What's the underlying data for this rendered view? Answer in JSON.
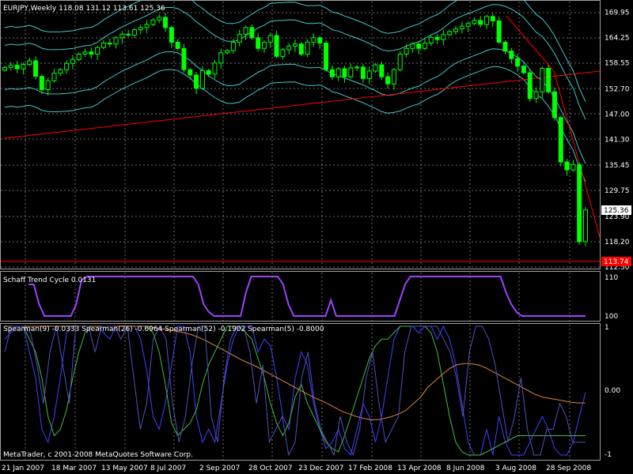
{
  "colors": {
    "background": "#000000",
    "candle": "#00ff00",
    "envelope": "#40c8c8",
    "trendline": "#ff0000",
    "stc": "#a040ff",
    "sp9": "#4040ff",
    "sp26": "#40c040",
    "sp52": "#e08040",
    "sp5": "#5050c0",
    "grid": "#6e6e6e",
    "current_price_box": "#ffffff",
    "low_price_box": "#ff0000"
  },
  "main_chart": {
    "title": "EURJPY,Weekly  118.08 131.12 113.61 125.36",
    "price_labels": [
      "169.95",
      "164.25",
      "158.55",
      "152.70",
      "147.00",
      "141.30",
      "135.45",
      "129.75",
      "123.90",
      "118.20",
      "112.50"
    ],
    "current_price": "125.36",
    "low_price": "113.74"
  },
  "stc_panel": {
    "title": "Schaff Trend Cycle 0.0131",
    "labels": [
      "110",
      "100"
    ]
  },
  "spearman_panel": {
    "title": "Spearman(9) -0.0333  Spearman(26) -0.6964  Spearman(52) -0.1902  Spearman(5) -0.8000",
    "labels": [
      "1",
      "0.00",
      "-1"
    ],
    "footer": "MetaTrader, c 2001-2008 MetaQuotes Software Corp."
  },
  "time_axis": {
    "labels": [
      "21 Jan 2007",
      "18 Mar 2007",
      "13 May 2007",
      "8 Jul 2007",
      "2 Sep 2007",
      "28 Oct 2007",
      "23 Dec 2007",
      "17 Feb 2008",
      "13 Apr 2008",
      "8 Jun 2008",
      "3 Aug 2008",
      "28 Sep 2008"
    ]
  },
  "chart_data": {
    "type": "candlestick",
    "symbol": "EURJPY",
    "timeframe": "Weekly",
    "closes": [
      157.5,
      158.0,
      157.2,
      158.2,
      159.0,
      155.5,
      152.5,
      154.5,
      156.2,
      157.0,
      158.4,
      159.3,
      160.5,
      161.0,
      160.5,
      162.0,
      163.0,
      162.8,
      164.2,
      165.0,
      164.8,
      166.0,
      166.5,
      167.2,
      168.2,
      168.8,
      166.5,
      163.2,
      161.8,
      157.0,
      155.8,
      152.8,
      156.8,
      156.0,
      158.5,
      160.8,
      161.3,
      163.2,
      165.0,
      166.5,
      164.2,
      161.8,
      163.2,
      164.7,
      160.0,
      161.5,
      162.3,
      162.8,
      160.5,
      163.2,
      164.2,
      163.0,
      157.0,
      155.4,
      157.2,
      155.4,
      157.4,
      157.6,
      155.0,
      156.7,
      158.1,
      155.4,
      153.8,
      157.0,
      160.5,
      161.8,
      162.8,
      161.8,
      163.0,
      164.3,
      163.8,
      164.9,
      165.6,
      166.2,
      166.8,
      167.4,
      168.1,
      167.2,
      169.0,
      168.0,
      163.2,
      161.2,
      159.5,
      157.8,
      156.3,
      150.5,
      152.0,
      157.3,
      152.0,
      146.2,
      136.2,
      134.4,
      135.6,
      118.2,
      125.36
    ],
    "y_range": [
      112.5,
      172.0
    ],
    "stc": {
      "title": "Schaff Trend Cycle",
      "range": [
        100,
        110
      ],
      "values": [
        108,
        108,
        103,
        100,
        100,
        100,
        100,
        100,
        100,
        103,
        109,
        110,
        110,
        110,
        110,
        110,
        110,
        110,
        110,
        110,
        110,
        110,
        110,
        110,
        110,
        110,
        110,
        110,
        110,
        110,
        110,
        110,
        108,
        103,
        101,
        100,
        100,
        100,
        100,
        100,
        100,
        106,
        110,
        110,
        110,
        110,
        110,
        110,
        108,
        103,
        100,
        100,
        100,
        100,
        100,
        100,
        100,
        104,
        100,
        100,
        100,
        100,
        100,
        100,
        100,
        100,
        100,
        100,
        100,
        100,
        104,
        108,
        110,
        110,
        110,
        110,
        110,
        110,
        110,
        110,
        110,
        110,
        110,
        110,
        110,
        110,
        110,
        110,
        110,
        110,
        106,
        103,
        101,
        100,
        100,
        100,
        100,
        100,
        100,
        100,
        100,
        100,
        100,
        100,
        100,
        100
      ]
    },
    "spearman": {
      "range": [
        -1,
        1
      ],
      "series": [
        {
          "name": "Spearman(9)",
          "values": [
            0.8,
            0.9,
            1,
            1,
            0.6,
            0.2,
            -0.6,
            -0.8,
            -0.4,
            0.2,
            0.9,
            1,
            1,
            1,
            1,
            1,
            0.9,
            0.8,
            1,
            1,
            1,
            1,
            0.8,
            0.3,
            -0.4,
            -0.6,
            -0.2,
            0.4,
            1,
            1,
            0.6,
            -0.4,
            -0.8,
            -0.6,
            -0.8,
            -0.2,
            0.4,
            0.8,
            1,
            1,
            1,
            0.6,
            0.8,
            0.7,
            0.2,
            -0.4,
            -0.6,
            0.2,
            0.6,
            0.4,
            -0.2,
            -0.6,
            -0.9,
            -0.8,
            -0.6,
            -0.9,
            -1,
            -0.6,
            -0.2,
            -0.4,
            -0.8,
            -0.4,
            0.2,
            0.8,
            1,
            1,
            1,
            0.9,
            1,
            1,
            0.8,
            1,
            0.8,
            0.4,
            -0.2,
            -0.8,
            -1,
            -1,
            -0.6,
            -1,
            -0.4,
            -0.8,
            -1,
            -1,
            -1,
            -0.8,
            -0.6,
            -0.4,
            -0.6,
            -0.9,
            -1,
            -1,
            -0.8,
            -0.4,
            -0.03
          ]
        },
        {
          "name": "Spearman(26)",
          "values": [
            1,
            1,
            1,
            1,
            0.8,
            0.6,
            0.2,
            -0.4,
            -0.7,
            -0.6,
            -0.3,
            0.2,
            0.6,
            0.9,
            1,
            1,
            1,
            1,
            1,
            1,
            1,
            1,
            1,
            1,
            0.9,
            0.6,
            0.1,
            -0.5,
            -0.7,
            -0.6,
            -0.5,
            -0.3,
            0.1,
            0.4,
            0.6,
            0.8,
            1,
            1,
            1,
            0.9,
            0.8,
            0.5,
            0.2,
            -0.2,
            -0.5,
            -0.7,
            -0.5,
            -0.1,
            0.1,
            -0.2,
            -0.4,
            -0.6,
            -0.8,
            -0.9,
            -0.95,
            -0.7,
            -0.4,
            -0.1,
            0.2,
            0.5,
            0.7,
            0.8,
            0.8,
            0.9,
            1,
            1,
            1,
            1,
            1,
            0.9,
            0.6,
            0.1,
            -0.4,
            -0.8,
            -0.95,
            -1,
            -1,
            -1,
            -0.95,
            -0.9,
            -0.85,
            -0.8,
            -0.75,
            -0.7,
            -0.7,
            -0.7,
            -0.7,
            -0.7,
            -0.7,
            -0.7,
            -0.7,
            -0.7,
            -0.7,
            -0.7,
            -0.7
          ]
        },
        {
          "name": "Spearman(52)",
          "values": [
            1,
            1,
            1,
            1,
            1,
            1,
            1,
            1,
            1,
            1,
            1,
            1,
            1,
            1,
            1,
            1,
            1,
            1,
            1,
            1,
            1,
            0.98,
            0.96,
            0.94,
            0.92,
            0.9,
            0.87,
            0.83,
            0.78,
            0.72,
            0.66,
            0.6,
            0.54,
            0.48,
            0.43,
            0.38,
            0.32,
            0.26,
            0.2,
            0.14,
            0.08,
            0.02,
            -0.04,
            -0.1,
            -0.15,
            -0.2,
            -0.26,
            -0.32,
            -0.36,
            -0.4,
            -0.43,
            -0.45,
            -0.45,
            -0.43,
            -0.4,
            -0.36,
            -0.3,
            -0.2,
            -0.1,
            0.05,
            0.15,
            0.25,
            0.34,
            0.4,
            0.42,
            0.42,
            0.4,
            0.36,
            0.3,
            0.24,
            0.18,
            0.12,
            0.06,
            0,
            -0.06,
            -0.1,
            -0.12,
            -0.14,
            -0.16,
            -0.18,
            -0.19,
            -0.19
          ]
        },
        {
          "name": "Spearman(5)",
          "values": [
            0.6,
            1,
            1,
            1,
            0.9,
            0.4,
            -0.2,
            0.6,
            1,
            0.4,
            -0.2,
            1,
            1,
            1,
            0.6,
            1,
            1,
            1,
            0.8,
            1,
            0.2,
            -0.6,
            -0.2,
            0.8,
            1,
            0.8,
            -0.2,
            -0.8,
            -0.4,
            0.4,
            1,
            1,
            -0.4,
            -0.8,
            0.2,
            0.8,
            1,
            1,
            0.6,
            -0.2,
            0.4,
            -0.8,
            -0.6,
            -0.4,
            -1,
            -0.8,
            0.2,
            0.6,
            -0.2,
            -0.6,
            -0.8,
            -1,
            -0.4,
            -0.8,
            -1,
            -0.6,
            0.2,
            0.6,
            -0.2,
            -0.8,
            -0.6,
            -0.4,
            0.6,
            1,
            1,
            1,
            1,
            1,
            0.8,
            0.6,
            0.2,
            -0.4,
            0.6,
            1,
            1,
            0.8,
            0.4,
            -0.2,
            -0.8,
            -0.4,
            0.2,
            -0.6,
            -1,
            -1,
            -0.6,
            -0.6,
            -0.2,
            -0.4,
            -0.8,
            -0.8,
            -0.8
          ]
        }
      ]
    }
  }
}
